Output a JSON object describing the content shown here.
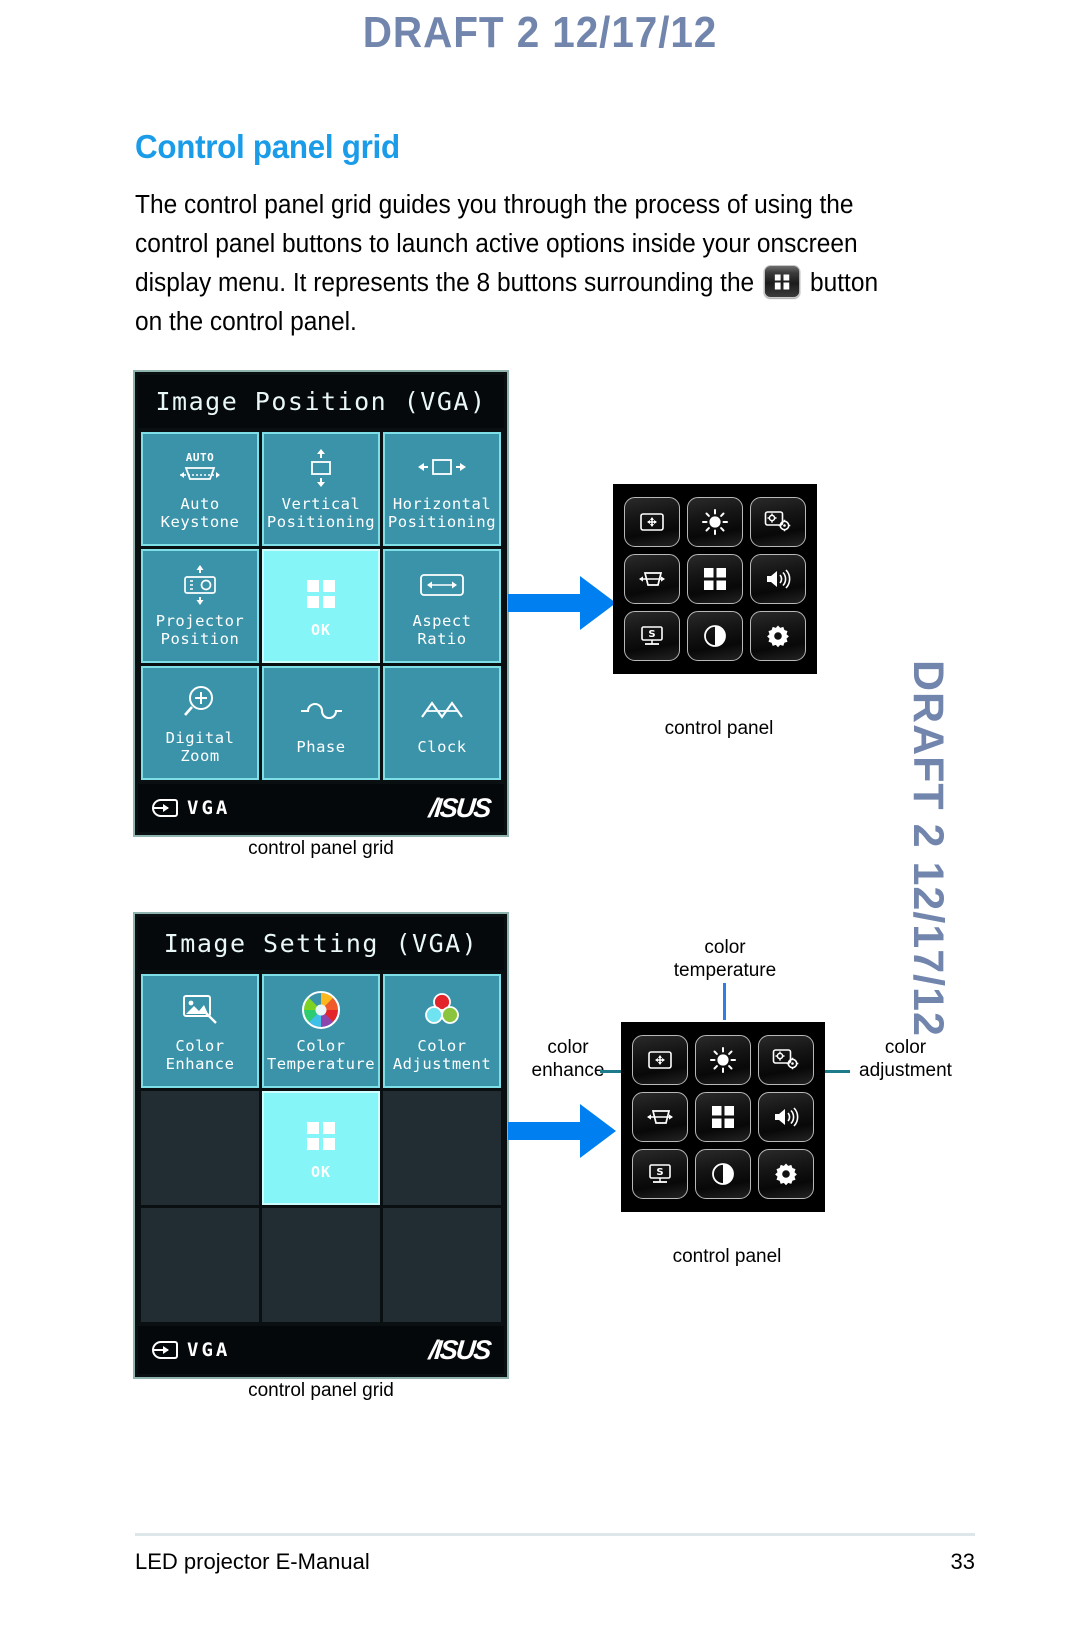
{
  "draft_watermark": {
    "top": "DRAFT 2   12/17/12",
    "side": "DRAFT 2   12/17/12"
  },
  "page": {
    "title": "Control panel grid",
    "body_part_1": "The control panel grid guides you through the process of using the control panel buttons to launch active options inside your onscreen display menu. It represents the 8 buttons surrounding the ",
    "body_part_2": " button on the control panel.",
    "inline_button_icon": "grid-button-icon"
  },
  "osd_panel_1": {
    "title": "Image Position (VGA)",
    "caption": "control panel grid",
    "source_label": "VGA",
    "brand": "/ISUS",
    "tiles": [
      {
        "icon": "auto-keystone-icon",
        "label": "Auto\nKeystone",
        "state": "normal"
      },
      {
        "icon": "vertical-positioning-icon",
        "label": "Vertical\nPositioning",
        "state": "normal"
      },
      {
        "icon": "horizontal-positioning-icon",
        "label": "Horizontal\nPositioning",
        "state": "normal"
      },
      {
        "icon": "projector-position-icon",
        "label": "Projector\nPosition",
        "state": "normal"
      },
      {
        "icon": "grid-ok-icon",
        "label": "OK",
        "state": "selected"
      },
      {
        "icon": "aspect-ratio-icon",
        "label": "Aspect\nRatio",
        "state": "normal"
      },
      {
        "icon": "digital-zoom-icon",
        "label": "Digital\nZoom",
        "state": "normal"
      },
      {
        "icon": "phase-icon",
        "label": "Phase",
        "state": "normal"
      },
      {
        "icon": "clock-icon",
        "label": "Clock",
        "state": "normal"
      }
    ]
  },
  "osd_panel_2": {
    "title": "Image Setting (VGA)",
    "caption": "control panel grid",
    "source_label": "VGA",
    "brand": "/ISUS",
    "tiles": [
      {
        "icon": "color-enhance-icon",
        "label": "Color\nEnhance",
        "state": "normal"
      },
      {
        "icon": "color-temperature-icon",
        "label": "Color\nTemperature",
        "state": "normal"
      },
      {
        "icon": "color-adjustment-icon",
        "label": "Color\nAdjustment",
        "state": "normal"
      },
      {
        "icon": "",
        "label": "",
        "state": "empty"
      },
      {
        "icon": "grid-ok-icon",
        "label": "OK",
        "state": "selected"
      },
      {
        "icon": "",
        "label": "",
        "state": "empty"
      },
      {
        "icon": "",
        "label": "",
        "state": "empty"
      },
      {
        "icon": "",
        "label": "",
        "state": "empty"
      },
      {
        "icon": "",
        "label": "",
        "state": "empty"
      }
    ]
  },
  "control_panel_1": {
    "caption": "control panel",
    "buttons": [
      "image-position-icon",
      "brightness-icon",
      "color-adjustment-icon",
      "keystone-icon",
      "grid-menu-icon",
      "volume-icon",
      "source-icon",
      "contrast-icon",
      "settings-gear-icon"
    ]
  },
  "control_panel_2": {
    "caption": "control panel",
    "buttons": [
      "image-position-icon",
      "brightness-icon",
      "color-adjustment-icon",
      "keystone-icon",
      "grid-menu-icon",
      "volume-icon",
      "source-icon",
      "contrast-icon",
      "settings-gear-icon"
    ],
    "annotations": {
      "top": "color\ntemperature",
      "left": "color\nenhance",
      "right": "color\nadjustment"
    }
  },
  "footer": {
    "left": "LED projector E-Manual",
    "page_number": "33"
  },
  "colors": {
    "draft": "#7286ad",
    "title_blue": "#1b9ce8",
    "tile_teal": "#3a93a9",
    "tile_border": "#7fdfe6",
    "tile_selected": "#86f5f7",
    "tile_empty": "#222d33",
    "arrow_blue": "#007ff0",
    "leader_teal": "#1e7b8c",
    "leader_blue": "#2f7fe0"
  }
}
